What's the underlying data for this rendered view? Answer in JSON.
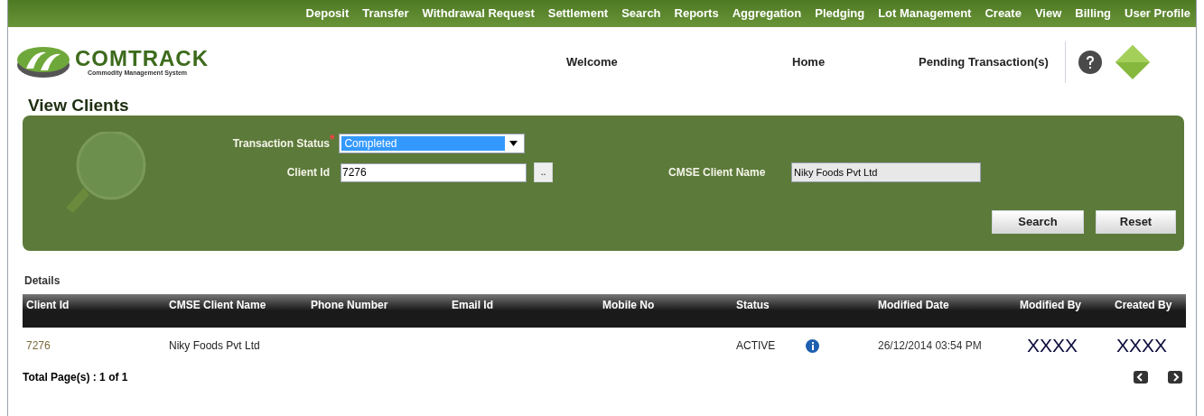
{
  "top_menu": [
    "Deposit",
    "Transfer",
    "Withdrawal Request",
    "Settlement",
    "Search",
    "Reports",
    "Aggregation",
    "Pledging",
    "Lot Management",
    "Create",
    "View",
    "Billing",
    "User Profile"
  ],
  "logo": {
    "name": "COMTRACK",
    "tagline": "Commodity Management System"
  },
  "header_links": [
    "Welcome",
    "Home",
    "Pending Transaction(s)"
  ],
  "page_title": "View Clients",
  "form": {
    "transaction_status": {
      "label": "Transaction Status",
      "required_mark": "*",
      "value": "Completed"
    },
    "client_id": {
      "label": "Client Id",
      "value": "7276",
      "lookup_button": ".."
    },
    "client_name": {
      "label": "CMSE Client Name",
      "value": "Niky Foods Pvt Ltd"
    },
    "buttons": [
      "Search",
      "Reset"
    ]
  },
  "details_label": "Details",
  "table": {
    "columns": [
      "Client Id",
      "CMSE Client Name",
      "Phone Number",
      "Email Id",
      "Mobile No",
      "Status",
      "",
      "Modified Date",
      "Modified By",
      "Created By"
    ],
    "rows": [
      {
        "client_id": "7276",
        "client_name": "Niky Foods Pvt Ltd",
        "phone": "",
        "email": "",
        "mobile": "",
        "status": "ACTIVE",
        "modified_date": "26/12/2014 03:54 PM",
        "modified_by": "XXXX",
        "created_by": "XXXX"
      }
    ]
  },
  "pagination": {
    "text": "Total Page(s) : 1 of 1"
  }
}
